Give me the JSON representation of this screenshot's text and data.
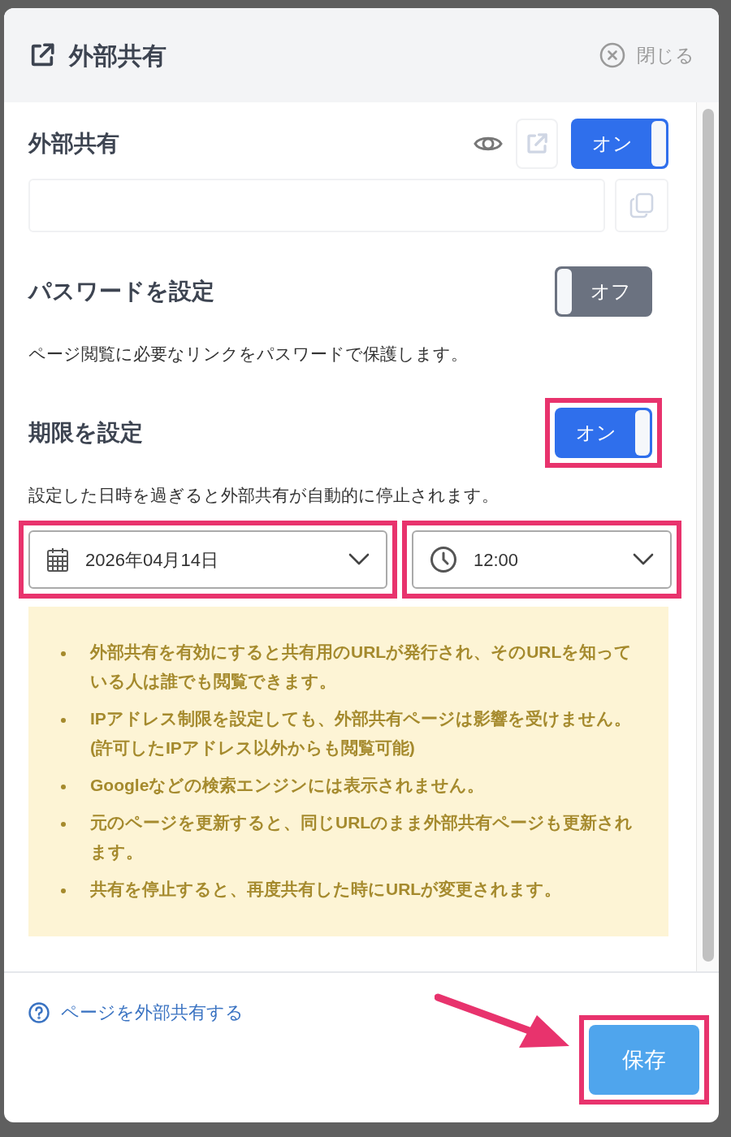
{
  "dialog": {
    "title": "外部共有",
    "close_label": "閉じる"
  },
  "external_share": {
    "title": "外部共有",
    "toggle": {
      "label": "オン",
      "on": true,
      "highlighted": false
    }
  },
  "password": {
    "title": "パスワードを設定",
    "toggle": {
      "label": "オフ",
      "on": false,
      "highlighted": false
    },
    "description": "ページ閲覧に必要なリンクをパスワードで保護します。"
  },
  "expiry": {
    "title": "期限を設定",
    "toggle": {
      "label": "オン",
      "on": true,
      "highlighted": true
    },
    "description": "設定した日時を過ぎると外部共有が自動的に停止されます。",
    "date": {
      "value": "2026年04月14日",
      "highlighted": true
    },
    "time": {
      "value": "12:00",
      "highlighted": true
    }
  },
  "notes": [
    "外部共有を有効にすると共有用のURLが発行され、そのURLを知っている人は誰でも閲覧できます。",
    "IPアドレス制限を設定しても、外部共有ページは影響を受けません。(許可したIPアドレス以外からも閲覧可能)",
    "Googleなどの検索エンジンには表示されません。",
    "元のページを更新すると、同じURLのまま外部共有ページも更新されます。",
    "共有を停止すると、再度共有した時にURLが変更されます。"
  ],
  "footer": {
    "help_link": "ページを外部共有する",
    "save_button": {
      "label": "保存",
      "highlighted": true
    },
    "arrow_to_save": true
  }
}
